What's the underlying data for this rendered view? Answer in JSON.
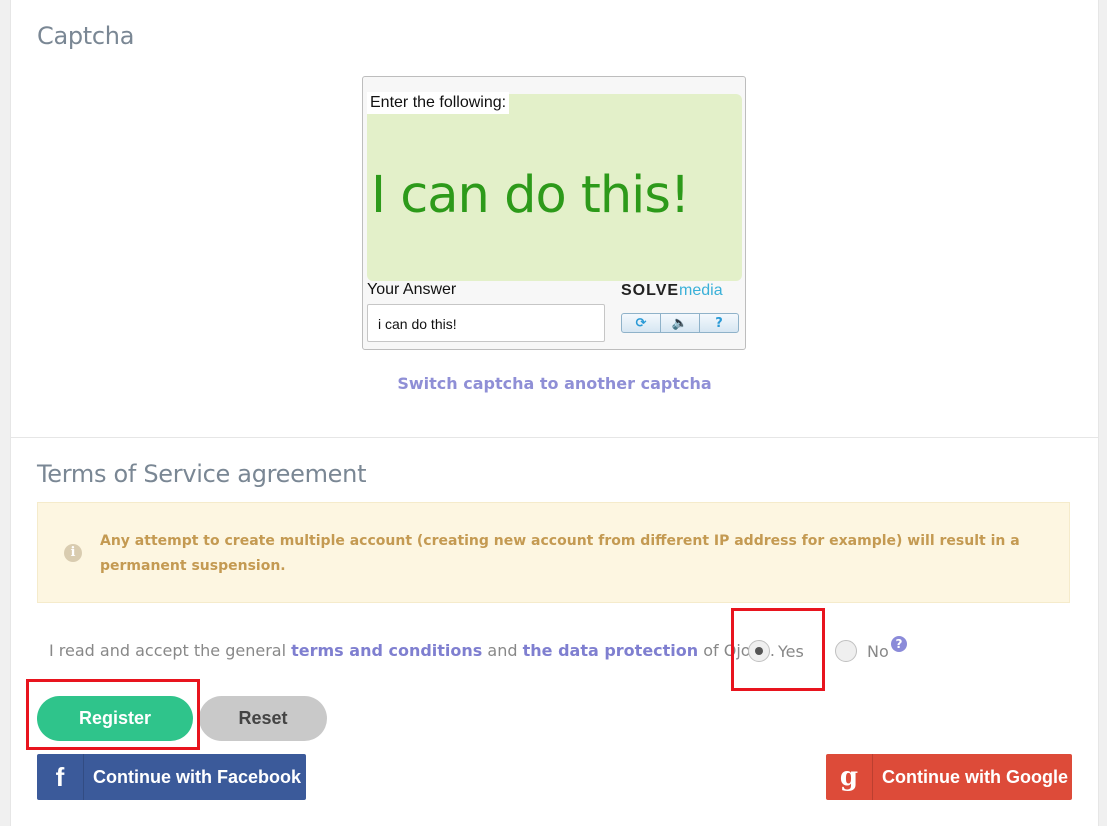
{
  "captcha": {
    "section_title": "Captcha",
    "instruction": "Enter the following:",
    "phrase": "I can do this!",
    "answer_label": "Your Answer",
    "answer_value": "i can do this!",
    "brand_part1": "SOLVE",
    "brand_part2": "media",
    "controls": [
      {
        "icon": "refresh-icon",
        "glyph": "⟳"
      },
      {
        "icon": "audio-icon",
        "glyph": "🔈"
      },
      {
        "icon": "help-icon",
        "glyph": "?"
      }
    ],
    "switch_link": "Switch captcha to another captcha"
  },
  "terms": {
    "section_title": "Terms of Service agreement",
    "alert_icon": "info-icon",
    "alert_text": "Any attempt to create multiple account (creating new account from different IP address for example) will result in a permanent suspension.",
    "line_prefix": "I read and accept the general ",
    "link_terms": "terms and conditions",
    "line_and": " and ",
    "link_data": "the data protection",
    "line_suffix": " of Ojooo.",
    "option_yes": "Yes",
    "option_no": "No",
    "selected": "Yes",
    "help_glyph": "?"
  },
  "actions": {
    "register_label": "Register",
    "reset_label": "Reset",
    "facebook_label": "Continue with Facebook",
    "facebook_glyph": "f",
    "google_label": "Continue with Google",
    "google_glyph": "g"
  },
  "colors": {
    "register": "#2fc48b",
    "facebook": "#3b5a9a",
    "google": "#dd4b39",
    "link": "#7f7fd0",
    "highlight": "#e8141e"
  }
}
